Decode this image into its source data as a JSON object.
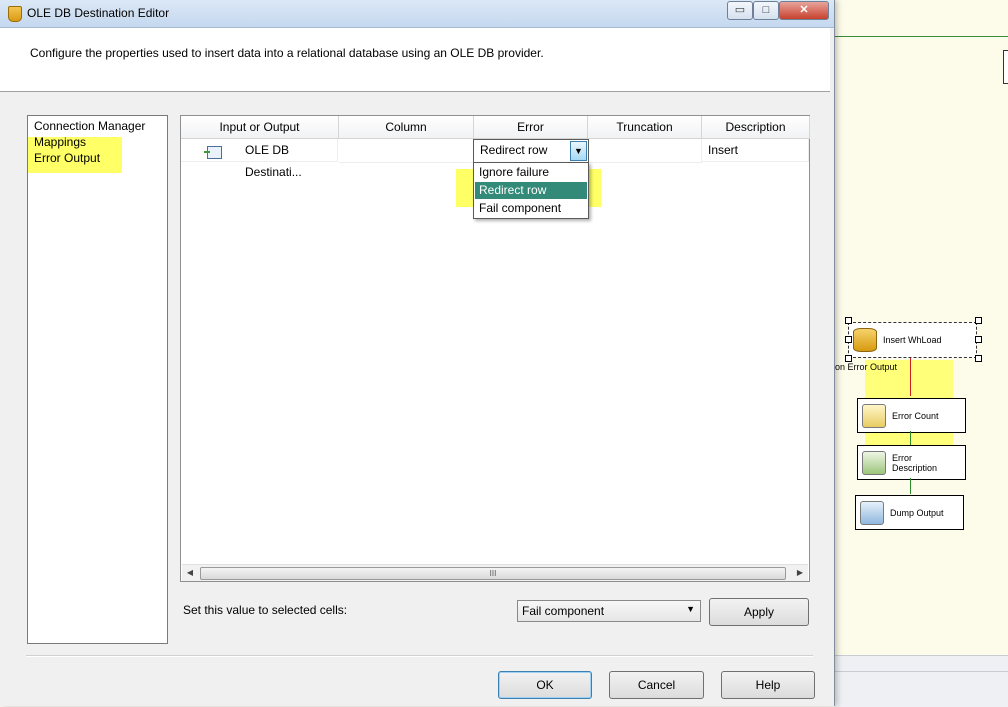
{
  "window": {
    "title": "OLE DB Destination Editor",
    "minimize_glyph": "▭",
    "maximize_glyph": "□",
    "close_glyph": "✕",
    "title_icon": "ssis-component-icon"
  },
  "header": {
    "description": "Configure the properties used to insert data into a relational database using an OLE DB provider."
  },
  "nav": {
    "items": [
      {
        "label": "Connection Manager",
        "highlighted": false
      },
      {
        "label": "Mappings",
        "highlighted": true
      },
      {
        "label": "Error Output",
        "highlighted": true
      }
    ],
    "highlight_color": "#ffff66"
  },
  "grid": {
    "columns": [
      "Input or Output",
      "Column",
      "Error",
      "Truncation",
      "Description"
    ],
    "rows": [
      {
        "input_or_output": "OLE DB Destinati...",
        "column": "",
        "error": "Redirect row",
        "truncation": "",
        "description": "Insert"
      }
    ],
    "error_dropdown": {
      "options": [
        "Ignore failure",
        "Redirect row",
        "Fail component"
      ],
      "selected": "Redirect row",
      "selected_color": "#338a78"
    },
    "scroll_thumb_glyph": "III",
    "scroll_left_glyph": "◀",
    "scroll_right_glyph": "▶"
  },
  "footer": {
    "set_value_label": "Set this value to selected cells:",
    "set_value_selected": "Fail component",
    "apply_label": "Apply",
    "ok_label": "OK",
    "cancel_label": "Cancel",
    "help_label": "Help"
  },
  "designer": {
    "tasks": [
      {
        "label": "Insert WhLoad",
        "icon": "database-cylinder-icon"
      },
      {
        "label": "Error Count",
        "icon": "row-count-icon"
      },
      {
        "label": "Error Description",
        "icon": "script-component-icon"
      },
      {
        "label": "Dump Output",
        "icon": "script-component-icon"
      }
    ],
    "path_label": "on Error Output",
    "error_path_color": "#d02020",
    "success_path_color": "#2a8a2a"
  }
}
